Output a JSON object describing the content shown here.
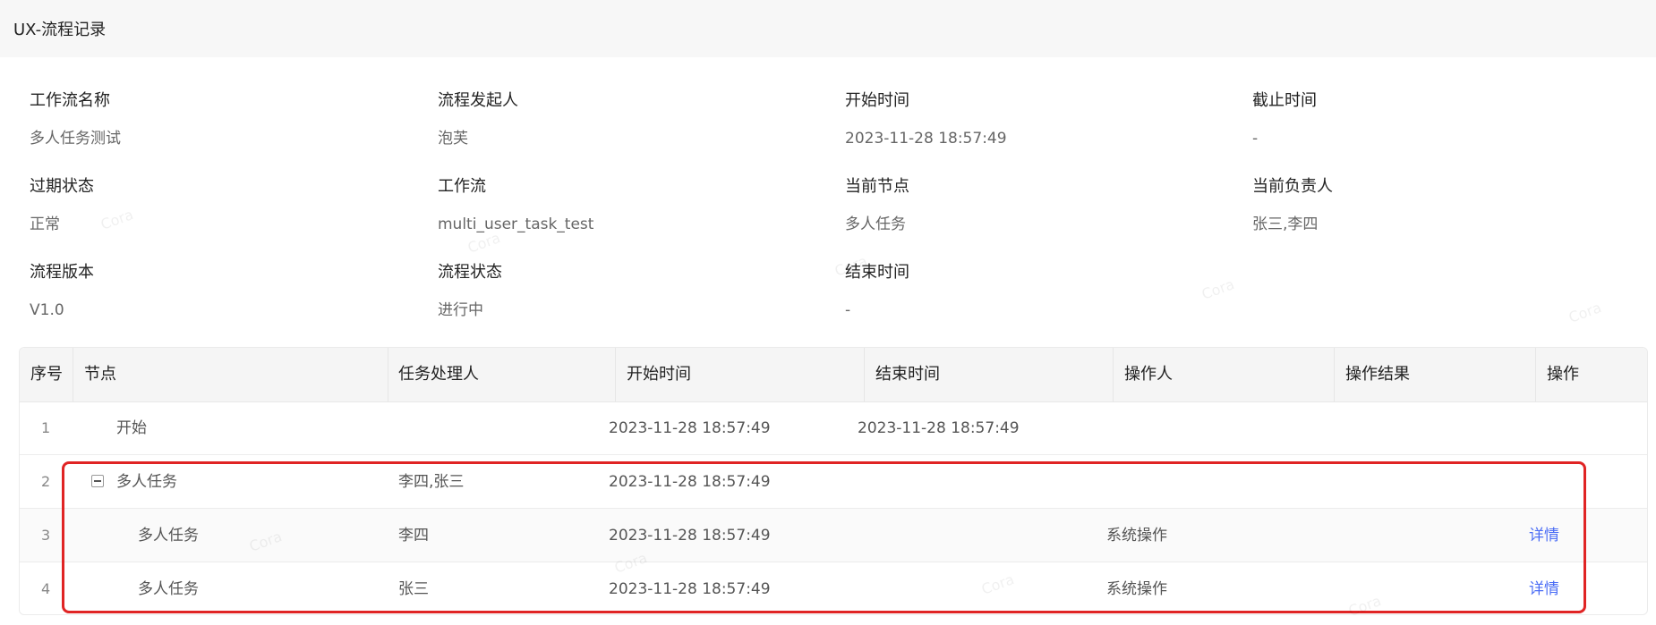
{
  "header": {
    "title": "UX-流程记录"
  },
  "info": {
    "rows": [
      [
        {
          "label": "工作流名称",
          "value": "多人任务测试"
        },
        {
          "label": "流程发起人",
          "value": "泡芙"
        },
        {
          "label": "开始时间",
          "value": "2023-11-28 18:57:49"
        },
        {
          "label": "截止时间",
          "value": "-"
        }
      ],
      [
        {
          "label": "过期状态",
          "value": "正常"
        },
        {
          "label": "工作流",
          "value": "multi_user_task_test"
        },
        {
          "label": "当前节点",
          "value": "多人任务"
        },
        {
          "label": "当前负责人",
          "value": "张三,李四"
        }
      ],
      [
        {
          "label": "流程版本",
          "value": "V1.0"
        },
        {
          "label": "流程状态",
          "value": "进行中"
        },
        {
          "label": "结束时间",
          "value": "-"
        }
      ]
    ]
  },
  "table": {
    "columns": [
      "序号",
      "节点",
      "任务处理人",
      "开始时间",
      "结束时间",
      "操作人",
      "操作结果",
      "操作"
    ],
    "rows": [
      {
        "index": "1",
        "node": "开始",
        "handler": "",
        "start": "2023-11-28 18:57:49",
        "end": "2023-11-28 18:57:49",
        "operator": "",
        "result": "",
        "action": ""
      },
      {
        "index": "2",
        "node": "多人任务",
        "handler": "李四,张三",
        "start": "2023-11-28 18:57:49",
        "end": "",
        "operator": "",
        "result": "",
        "action": ""
      },
      {
        "index": "3",
        "node": "多人任务",
        "handler": "李四",
        "start": "2023-11-28 18:57:49",
        "end": "",
        "operator": "系统操作",
        "result": "",
        "action": "详情"
      },
      {
        "index": "4",
        "node": "多人任务",
        "handler": "张三",
        "start": "2023-11-28 18:57:49",
        "end": "",
        "operator": "系统操作",
        "result": "",
        "action": "详情"
      }
    ]
  },
  "watermark": "Cora",
  "colors": {
    "link": "#4c6ef5",
    "highlight": "#e02424",
    "header_bg": "#f7f7f7"
  }
}
